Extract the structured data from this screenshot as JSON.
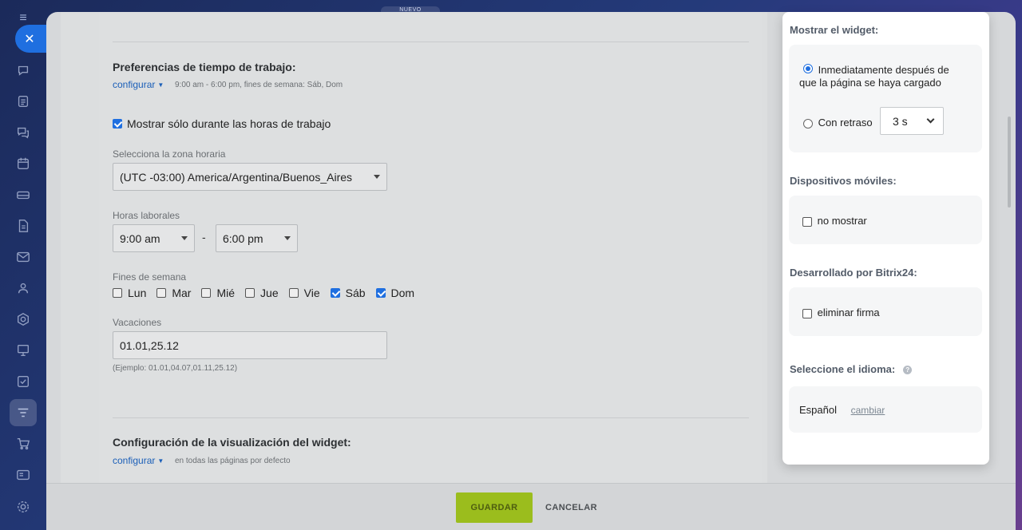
{
  "rail": {
    "menu_icon": "menu-icon",
    "close_icon": "close-icon",
    "close_glyph": "✕",
    "menu_glyph": "≡"
  },
  "badge": {
    "nuevo": "NUEVO"
  },
  "work_time": {
    "title": "Preferencias de tiempo de trabajo:",
    "configure": "configurar",
    "summary": "9:00 am - 6:00 pm, fines de semana: Sáb, Dom",
    "only_work_hours": "Mostrar sólo durante las horas de trabajo",
    "timezone_label": "Selecciona la zona horaria",
    "timezone_value": "(UTC -03:00) America/Argentina/Buenos_Aires",
    "hours_label": "Horas laborales",
    "hours_from": "9:00 am",
    "hours_sep": "-",
    "hours_to": "6:00 pm",
    "weekends_label": "Fines de semana",
    "days": [
      {
        "label": "Lun",
        "checked": false
      },
      {
        "label": "Mar",
        "checked": false
      },
      {
        "label": "Mié",
        "checked": false
      },
      {
        "label": "Jue",
        "checked": false
      },
      {
        "label": "Vie",
        "checked": false
      },
      {
        "label": "Sáb",
        "checked": true
      },
      {
        "label": "Dom",
        "checked": true
      }
    ],
    "holidays_label": "Vacaciones",
    "holidays_value": "01.01,25.12",
    "holidays_hint": "(Ejemplo: 01.01,04.07,01.11,25.12)"
  },
  "display": {
    "title": "Configuración de la visualización del widget:",
    "configure": "configurar",
    "summary": "en todas las páginas por defecto"
  },
  "footer": {
    "save": "GUARDAR",
    "cancel": "CANCELAR"
  },
  "popup": {
    "show_title": "Mostrar el widget:",
    "immediately_line1": "Inmediatamente después de",
    "immediately_line2": "que la página se haya cargado",
    "delay_label": "Con retraso",
    "delay_value": "3 s",
    "mobile_title": "Dispositivos móviles:",
    "mobile_option": "no mostrar",
    "bitrix_title": "Desarrollado por Bitrix24:",
    "bitrix_option": "eliminar firma",
    "lang_title": "Seleccione el idioma:",
    "lang_help": "?",
    "lang_value": "Español",
    "lang_change": "cambiar"
  }
}
